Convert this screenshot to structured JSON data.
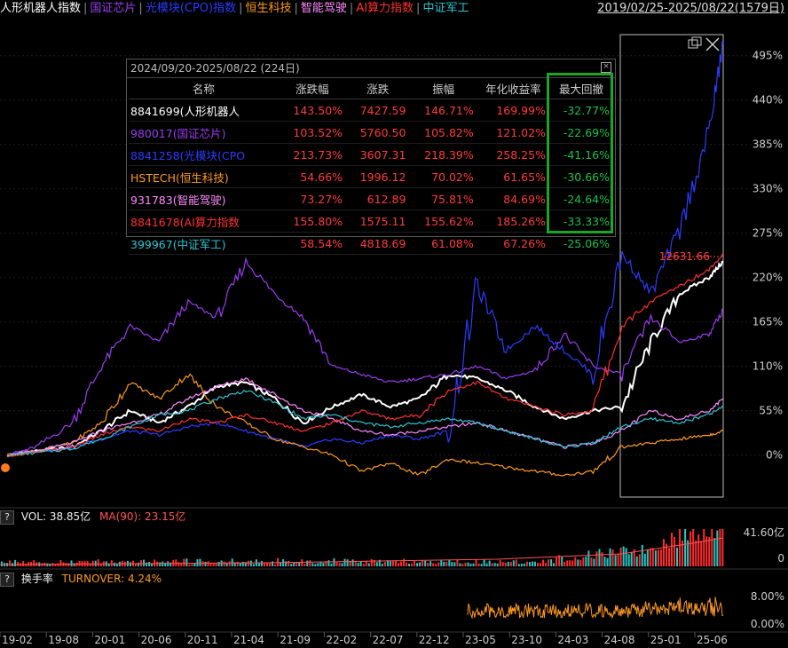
{
  "header": {
    "indices": [
      {
        "label": "人形机器人指数",
        "color": "#ffffff"
      },
      {
        "label": "国证芯片",
        "color": "#9b3cf0"
      },
      {
        "label": "光模块(CPO)指数",
        "color": "#2b3cff"
      },
      {
        "label": "恒生科技",
        "color": "#ff9a1f"
      },
      {
        "label": "智能驾驶",
        "color": "#ff8aff"
      },
      {
        "label": "AI算力指数",
        "color": "#ff3030"
      },
      {
        "label": "中证军工",
        "color": "#2ec4d0"
      }
    ],
    "date_range": "2019/02/25-2025/08/22(1579日)"
  },
  "stats_table": {
    "title": "2024/09/20-2025/08/22 (224日)",
    "close_symbol": "×",
    "columns": [
      "名称",
      "涨跌幅",
      "涨跌",
      "振幅",
      "年化收益率",
      "最大回撤"
    ],
    "rows": [
      {
        "name": "8841699(人形机器人",
        "color": "#ffffff",
        "pct": "143.50%",
        "chg": "7427.59",
        "amp": "146.71%",
        "ann": "169.99%",
        "dd": "-32.77%"
      },
      {
        "name": "980017(国证芯片)",
        "color": "#9b3cf0",
        "pct": "103.52%",
        "chg": "5760.50",
        "amp": "105.82%",
        "ann": "121.02%",
        "dd": "-22.69%"
      },
      {
        "name": "8841258(光模块(CPO",
        "color": "#2b3cff",
        "pct": "213.73%",
        "chg": "3607.31",
        "amp": "218.39%",
        "ann": "258.25%",
        "dd": "-41.16%"
      },
      {
        "name": "HSTECH(恒生科技)",
        "color": "#ff9a1f",
        "pct": "54.66%",
        "chg": "1996.12",
        "amp": "70.02%",
        "ann": "61.65%",
        "dd": "-30.66%"
      },
      {
        "name": "931783(智能驾驶)",
        "color": "#ff8aff",
        "pct": "73.27%",
        "chg": "612.89",
        "amp": "75.81%",
        "ann": "84.69%",
        "dd": "-24.64%"
      },
      {
        "name": "8841678(AI算力指数",
        "color": "#ff3030",
        "pct": "155.80%",
        "chg": "1575.11",
        "amp": "155.62%",
        "ann": "185.26%",
        "dd": "-33.33%"
      },
      {
        "name": "399967(中证军工)",
        "color": "#2ec4d0",
        "pct": "58.54%",
        "chg": "4818.69",
        "amp": "61.08%",
        "ann": "67.26%",
        "dd": "-25.06%"
      }
    ]
  },
  "chart_data": [
    {
      "type": "line",
      "y_ticks": [
        "495%",
        "440%",
        "385%",
        "330%",
        "275%",
        "220%",
        "165%",
        "110%",
        "55%",
        "0%"
      ],
      "ylim": [
        -30,
        520
      ],
      "x_ticks": [
        "19-02",
        "19-08",
        "20-01",
        "20-06",
        "20-11",
        "21-04",
        "21-09",
        "22-02",
        "22-07",
        "22-12",
        "23-05",
        "23-10",
        "24-03",
        "24-08",
        "25-01",
        "25-06"
      ],
      "price_label": "12631.66",
      "series": [
        {
          "name": "人形机器人指数",
          "color": "#ffffff",
          "x": [
            0.01,
            0.05,
            0.1,
            0.14,
            0.18,
            0.22,
            0.26,
            0.3,
            0.34,
            0.38,
            0.42,
            0.46,
            0.5,
            0.54,
            0.58,
            0.62,
            0.66,
            0.7,
            0.74,
            0.78,
            0.82,
            0.86,
            0.9,
            0.94,
            0.98,
            1.0
          ],
          "values": [
            0,
            5,
            10,
            30,
            55,
            40,
            60,
            85,
            90,
            70,
            40,
            60,
            75,
            60,
            70,
            100,
            95,
            80,
            60,
            45,
            55,
            60,
            140,
            200,
            220,
            240
          ]
        },
        {
          "name": "国证芯片",
          "color": "#9b3cf0",
          "x": [
            0.01,
            0.05,
            0.1,
            0.14,
            0.18,
            0.22,
            0.26,
            0.3,
            0.34,
            0.38,
            0.42,
            0.46,
            0.5,
            0.54,
            0.58,
            0.62,
            0.66,
            0.7,
            0.74,
            0.78,
            0.82,
            0.86,
            0.9,
            0.94,
            0.98,
            1.0
          ],
          "values": [
            0,
            10,
            40,
            110,
            160,
            140,
            190,
            170,
            240,
            200,
            170,
            110,
            100,
            90,
            95,
            100,
            110,
            95,
            105,
            150,
            110,
            100,
            170,
            140,
            150,
            180
          ]
        },
        {
          "name": "光模块(CPO)指数",
          "color": "#2b3cff",
          "x": [
            0.01,
            0.05,
            0.1,
            0.14,
            0.18,
            0.22,
            0.26,
            0.3,
            0.34,
            0.38,
            0.42,
            0.46,
            0.5,
            0.54,
            0.58,
            0.62,
            0.66,
            0.7,
            0.74,
            0.78,
            0.82,
            0.86,
            0.9,
            0.94,
            0.98,
            1.0
          ],
          "values": [
            0,
            5,
            10,
            20,
            30,
            25,
            35,
            40,
            30,
            20,
            10,
            20,
            15,
            25,
            20,
            30,
            210,
            130,
            160,
            130,
            100,
            250,
            200,
            280,
            400,
            510
          ]
        },
        {
          "name": "恒生科技",
          "color": "#ff9a1f",
          "x": [
            0.01,
            0.05,
            0.1,
            0.14,
            0.18,
            0.22,
            0.26,
            0.3,
            0.34,
            0.38,
            0.42,
            0.46,
            0.5,
            0.54,
            0.58,
            0.62,
            0.66,
            0.7,
            0.74,
            0.78,
            0.82,
            0.86,
            0.9,
            0.94,
            0.98,
            1.0
          ],
          "values": [
            0,
            5,
            15,
            40,
            90,
            70,
            100,
            60,
            40,
            20,
            10,
            0,
            -20,
            -10,
            -25,
            -5,
            -10,
            -15,
            -20,
            -25,
            -20,
            10,
            15,
            20,
            25,
            30
          ]
        },
        {
          "name": "智能驾驶",
          "color": "#ff8aff",
          "x": [
            0.01,
            0.05,
            0.1,
            0.14,
            0.18,
            0.22,
            0.26,
            0.3,
            0.34,
            0.38,
            0.42,
            0.46,
            0.5,
            0.54,
            0.58,
            0.62,
            0.66,
            0.7,
            0.74,
            0.78,
            0.82,
            0.86,
            0.9,
            0.94,
            0.98,
            1.0
          ],
          "values": [
            0,
            5,
            15,
            30,
            40,
            50,
            70,
            85,
            95,
            75,
            55,
            45,
            30,
            25,
            30,
            35,
            40,
            30,
            20,
            10,
            15,
            30,
            55,
            45,
            55,
            70
          ]
        },
        {
          "name": "AI算力指数",
          "color": "#ff3030",
          "x": [
            0.01,
            0.05,
            0.1,
            0.14,
            0.18,
            0.22,
            0.26,
            0.3,
            0.34,
            0.38,
            0.42,
            0.46,
            0.5,
            0.54,
            0.58,
            0.62,
            0.66,
            0.7,
            0.74,
            0.78,
            0.82,
            0.86,
            0.9,
            0.94,
            0.98,
            1.0
          ],
          "values": [
            0,
            3,
            10,
            25,
            35,
            30,
            45,
            40,
            50,
            40,
            30,
            40,
            55,
            45,
            50,
            80,
            90,
            70,
            60,
            50,
            55,
            160,
            190,
            210,
            230,
            250
          ]
        },
        {
          "name": "中证军工",
          "color": "#2ec4d0",
          "x": [
            0.01,
            0.05,
            0.1,
            0.14,
            0.18,
            0.22,
            0.26,
            0.3,
            0.34,
            0.38,
            0.42,
            0.46,
            0.5,
            0.54,
            0.58,
            0.62,
            0.66,
            0.7,
            0.74,
            0.78,
            0.82,
            0.86,
            0.9,
            0.94,
            0.98,
            1.0
          ],
          "values": [
            0,
            3,
            8,
            20,
            35,
            50,
            55,
            70,
            80,
            65,
            45,
            50,
            40,
            35,
            40,
            45,
            40,
            30,
            20,
            10,
            15,
            35,
            45,
            40,
            50,
            60
          ]
        }
      ]
    },
    {
      "type": "bar",
      "title": "VOL: 38.85亿",
      "ma_label": "MA(90): 23.15亿",
      "y_ticks": [
        "41.60亿",
        "0"
      ]
    },
    {
      "type": "line",
      "title": "换手率",
      "turnover_label": "TURNOVER: 4.24%",
      "y_ticks": [
        "8.00%",
        "0.00%"
      ]
    }
  ]
}
